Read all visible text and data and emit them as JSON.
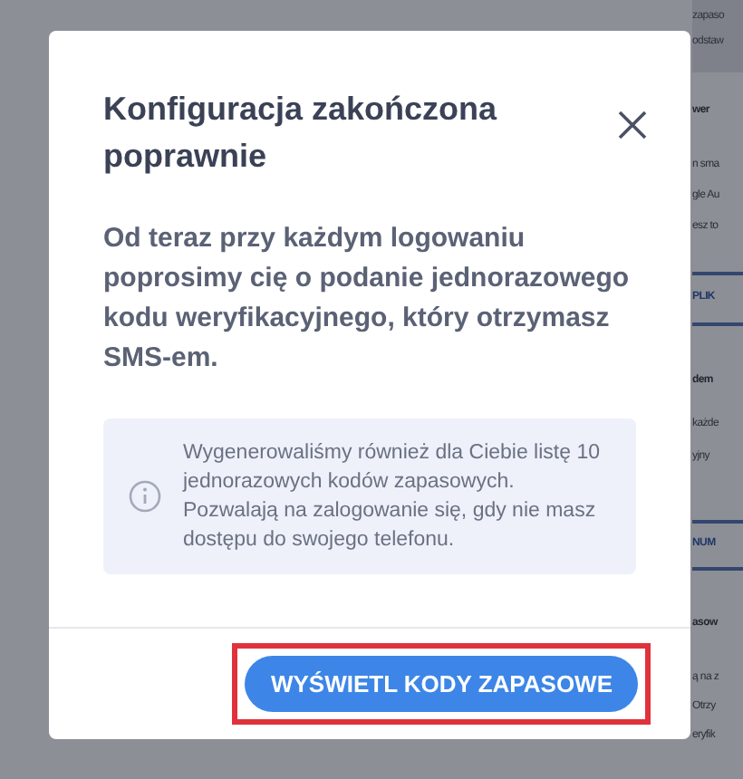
{
  "background_page": [
    {
      "kind": "band",
      "text": "zapaso"
    },
    {
      "kind": "band",
      "text": "odstaw"
    },
    {
      "kind": "heading",
      "text": "wer"
    },
    {
      "kind": "line",
      "text": "n sma"
    },
    {
      "kind": "line",
      "text": "gle Au"
    },
    {
      "kind": "line",
      "text": "esz to"
    },
    {
      "kind": "link",
      "text": "PLIK"
    },
    {
      "kind": "heading",
      "text": "dem"
    },
    {
      "kind": "line",
      "text": "każde"
    },
    {
      "kind": "line",
      "text": "yjny"
    },
    {
      "kind": "link",
      "text": "NUM"
    },
    {
      "kind": "heading",
      "text": "asow"
    },
    {
      "kind": "line",
      "text": "ą na z"
    },
    {
      "kind": "line",
      "text": "Otrzy"
    },
    {
      "kind": "line",
      "text": "eryfik"
    }
  ],
  "dialog": {
    "title": "Konfiguracja zakończona poprawnie",
    "message": "Od teraz przy każdym logowaniu poprosimy cię o podanie jednorazowego kodu weryfikacyjnego, który otrzymasz SMS-em.",
    "info": "Wygenerowaliśmy również dla Ciebie listę 10 jednorazowych kodów zapasowych. Pozwalają na zalogowanie się, gdy nie masz dostępu do swojego telefonu.",
    "button": {
      "label": "WYŚWIETL KODY ZAPASOWE",
      "highlighted": true
    }
  }
}
